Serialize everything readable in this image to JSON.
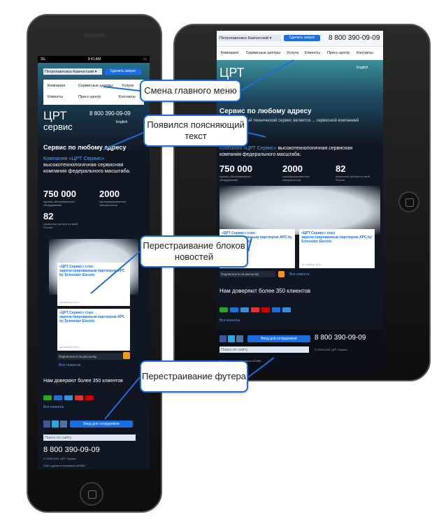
{
  "callouts": {
    "menu": "Смена главного меню",
    "text": "Появился поясняющий текст",
    "news": "Перестраивание блоков новостей",
    "footer": "Перестраивание футера"
  },
  "site": {
    "status_carrier": "3G",
    "status_time": "9:41 AM",
    "city": "Петропавловск-Камчатский",
    "request_button": "Сделать запрос",
    "menu": [
      "Компания",
      "Сервисные центры",
      "Услуги",
      "Клиенты",
      "Пресс-центр",
      "Контакты"
    ],
    "phone": "8 800 390-09-09",
    "lang": "English",
    "logo_top": "ЦРТ",
    "logo_bottom": "сервис",
    "tagline": "Сервис по любому адресу",
    "tagline_desc": "... региональный технический сервис является ... сервисной компанией федерального",
    "intro_link": "Компания «ЦРТ Сервис»",
    "intro_rest": "высокотехнологичная сервисная компания федерального масштаба.",
    "stats": [
      {
        "value": "750 000",
        "label": "единиц обслуживаемого оборудования"
      },
      {
        "value": "2000",
        "label": "сертифицированных специалистов"
      },
      {
        "value": "82",
        "label": "сервисных центра по всей России"
      }
    ],
    "news": [
      {
        "title": "«ЦРТ Сервис» стал зарегистрированным партнером APC by Schneider Electric",
        "date": "18 ноября 2011"
      },
      {
        "title": "«ЦРТ Сервис» стал зарегистрированным партнером APC by Schneider Electric",
        "date": "18 ноября 2011"
      }
    ],
    "subscribe": "Подписаться на рассылку",
    "all_news": "Все новости",
    "trust": "Нам доверяют более 350 клиентов",
    "all_clients": "Все клиенты",
    "staff_login": "Вход для сотрудников",
    "search_placeholder": "Поиск по сайту",
    "copyright": "© 2009-2011 ЦРТ Сервис",
    "made_by": "Сайт сделан в компании AGIMA"
  },
  "colors": {
    "accent": "#1d6fd6",
    "bg_dark": "#101722",
    "link": "#4aa3ff"
  }
}
